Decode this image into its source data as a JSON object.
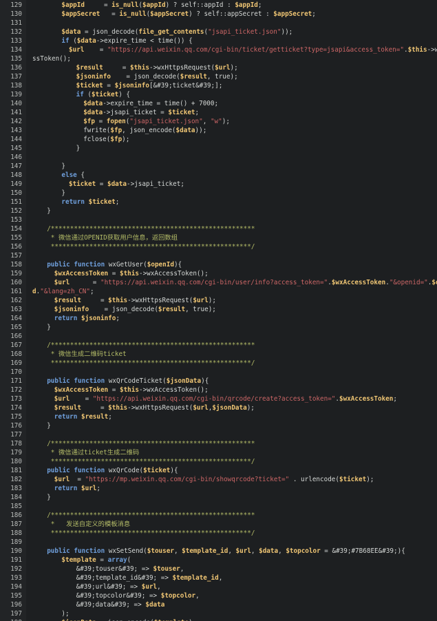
{
  "lines": [
    {
      "n": "129",
      "i": 4,
      "t": [
        [
          "v",
          "$appId"
        ],
        [
          "p",
          "     = "
        ],
        [
          "f",
          "is_null"
        ],
        [
          "p",
          "("
        ],
        [
          "v",
          "$appId"
        ],
        [
          "p",
          ") ? self::appId : "
        ],
        [
          "v",
          "$appId"
        ],
        [
          "p",
          ";"
        ]
      ]
    },
    {
      "n": "130",
      "i": 4,
      "t": [
        [
          "v",
          "$appSecret"
        ],
        [
          "p",
          "   = "
        ],
        [
          "f",
          "is_null"
        ],
        [
          "p",
          "("
        ],
        [
          "v",
          "$appSecret"
        ],
        [
          "p",
          ") ? self::appSecret : "
        ],
        [
          "v",
          "$appSecret"
        ],
        [
          "p",
          ";"
        ]
      ]
    },
    {
      "n": "131",
      "i": 0,
      "t": []
    },
    {
      "n": "132",
      "i": 4,
      "t": [
        [
          "v",
          "$data"
        ],
        [
          "p",
          " = json_decode("
        ],
        [
          "f",
          "file_get_contents"
        ],
        [
          "p",
          "("
        ],
        [
          "s",
          "\"jsapi_ticket.json\""
        ],
        [
          "p",
          "));"
        ]
      ]
    },
    {
      "n": "133",
      "i": 4,
      "t": [
        [
          "k",
          "if"
        ],
        [
          "p",
          " ("
        ],
        [
          "v",
          "$data"
        ],
        [
          "p",
          "->expire_time < time()) {"
        ]
      ]
    },
    {
      "n": "134",
      "i": 5,
      "t": [
        [
          "v",
          "$url"
        ],
        [
          "p",
          "    = "
        ],
        [
          "s",
          "\"https://api.weixin.qq.com/cgi-bin/ticket/getticket?type=jsapi&access_token=\""
        ],
        [
          "p",
          "."
        ],
        [
          "v",
          "$this"
        ],
        [
          "p",
          "->wxAcce"
        ]
      ]
    },
    {
      "n": "135",
      "i": 0,
      "t": [
        [
          "p",
          "ssToken();"
        ]
      ]
    },
    {
      "n": "136",
      "i": 6,
      "t": [
        [
          "v",
          "$result"
        ],
        [
          "p",
          "     = "
        ],
        [
          "v",
          "$this"
        ],
        [
          "p",
          "->wxHttpsRequest("
        ],
        [
          "v",
          "$url"
        ],
        [
          "p",
          ");"
        ]
      ]
    },
    {
      "n": "137",
      "i": 6,
      "t": [
        [
          "v",
          "$jsoninfo"
        ],
        [
          "p",
          "    = json_decode("
        ],
        [
          "v",
          "$result"
        ],
        [
          "p",
          ", true);"
        ]
      ]
    },
    {
      "n": "138",
      "i": 6,
      "t": [
        [
          "v",
          "$ticket"
        ],
        [
          "p",
          " = "
        ],
        [
          "v",
          "$jsoninfo"
        ],
        [
          "p",
          "[&#39;ticket&#39;];"
        ]
      ]
    },
    {
      "n": "139",
      "i": 6,
      "t": [
        [
          "k",
          "if"
        ],
        [
          "p",
          " ("
        ],
        [
          "v",
          "$ticket"
        ],
        [
          "p",
          ") {"
        ]
      ]
    },
    {
      "n": "140",
      "i": 7,
      "t": [
        [
          "v",
          "$data"
        ],
        [
          "p",
          "->expire_time = time() + 7000;"
        ]
      ]
    },
    {
      "n": "141",
      "i": 7,
      "t": [
        [
          "v",
          "$data"
        ],
        [
          "p",
          "->jsapi_ticket = "
        ],
        [
          "v",
          "$ticket"
        ],
        [
          "p",
          ";"
        ]
      ]
    },
    {
      "n": "142",
      "i": 7,
      "t": [
        [
          "v",
          "$fp"
        ],
        [
          "p",
          " = "
        ],
        [
          "f",
          "fopen"
        ],
        [
          "p",
          "("
        ],
        [
          "s",
          "\"jsapi_ticket.json\""
        ],
        [
          "p",
          ", "
        ],
        [
          "s",
          "\"w\""
        ],
        [
          "p",
          ");"
        ]
      ]
    },
    {
      "n": "143",
      "i": 7,
      "t": [
        [
          "p",
          "fwrite("
        ],
        [
          "v",
          "$fp"
        ],
        [
          "p",
          ", json_encode("
        ],
        [
          "v",
          "$data"
        ],
        [
          "p",
          "));"
        ]
      ]
    },
    {
      "n": "144",
      "i": 7,
      "t": [
        [
          "p",
          "fclose("
        ],
        [
          "v",
          "$fp"
        ],
        [
          "p",
          ");"
        ]
      ]
    },
    {
      "n": "145",
      "i": 6,
      "t": [
        [
          "p",
          "}"
        ]
      ]
    },
    {
      "n": "146",
      "i": 0,
      "t": []
    },
    {
      "n": "147",
      "i": 4,
      "t": [
        [
          "p",
          "}"
        ]
      ]
    },
    {
      "n": "148",
      "i": 4,
      "t": [
        [
          "k",
          "else"
        ],
        [
          "p",
          " {"
        ]
      ]
    },
    {
      "n": "149",
      "i": 5,
      "t": [
        [
          "v",
          "$ticket"
        ],
        [
          "p",
          " = "
        ],
        [
          "v",
          "$data"
        ],
        [
          "p",
          "->jsapi_ticket;"
        ]
      ]
    },
    {
      "n": "150",
      "i": 4,
      "t": [
        [
          "p",
          "}"
        ]
      ]
    },
    {
      "n": "151",
      "i": 4,
      "t": [
        [
          "k",
          "return"
        ],
        [
          "p",
          " "
        ],
        [
          "v",
          "$ticket"
        ],
        [
          "p",
          ";"
        ]
      ]
    },
    {
      "n": "152",
      "i": 2,
      "t": [
        [
          "p",
          "}"
        ]
      ]
    },
    {
      "n": "153",
      "i": 0,
      "t": []
    },
    {
      "n": "154",
      "i": 2,
      "t": [
        [
          "c",
          "/*****************************************************"
        ]
      ]
    },
    {
      "n": "155",
      "i": 2,
      "t": [
        [
          "c",
          " * 微信通过OPENID获取用户信息，返回数组"
        ]
      ]
    },
    {
      "n": "156",
      "i": 2,
      "t": [
        [
          "c",
          " ****************************************************/"
        ]
      ]
    },
    {
      "n": "157",
      "i": 0,
      "t": []
    },
    {
      "n": "158",
      "i": 2,
      "t": [
        [
          "k",
          "public"
        ],
        [
          "p",
          " "
        ],
        [
          "k",
          "function"
        ],
        [
          "p",
          " wxGetUser("
        ],
        [
          "v",
          "$openId"
        ],
        [
          "p",
          "){"
        ]
      ]
    },
    {
      "n": "159",
      "i": 3,
      "t": [
        [
          "v",
          "$wxAccessToken"
        ],
        [
          "p",
          " = "
        ],
        [
          "v",
          "$this"
        ],
        [
          "p",
          "->wxAccessToken();"
        ]
      ]
    },
    {
      "n": "160",
      "i": 3,
      "t": [
        [
          "v",
          "$url"
        ],
        [
          "p",
          "      = "
        ],
        [
          "s",
          "\"https://api.weixin.qq.com/cgi-bin/user/info?access_token=\""
        ],
        [
          "p",
          "."
        ],
        [
          "v",
          "$wxAccessToken"
        ],
        [
          "p",
          "."
        ],
        [
          "s",
          "\"&openid=\""
        ],
        [
          "p",
          "."
        ],
        [
          "v",
          "$openI"
        ]
      ]
    },
    {
      "n": "161",
      "i": 0,
      "t": [
        [
          "v",
          "d"
        ],
        [
          "p",
          "."
        ],
        [
          "s",
          "\"&lang=zh_CN\""
        ],
        [
          "p",
          ";"
        ]
      ]
    },
    {
      "n": "162",
      "i": 3,
      "t": [
        [
          "v",
          "$result"
        ],
        [
          "p",
          "     = "
        ],
        [
          "v",
          "$this"
        ],
        [
          "p",
          "->wxHttpsRequest("
        ],
        [
          "v",
          "$url"
        ],
        [
          "p",
          ");"
        ]
      ]
    },
    {
      "n": "163",
      "i": 3,
      "t": [
        [
          "v",
          "$jsoninfo"
        ],
        [
          "p",
          "    = json_decode("
        ],
        [
          "v",
          "$result"
        ],
        [
          "p",
          ", true);"
        ]
      ]
    },
    {
      "n": "164",
      "i": 3,
      "t": [
        [
          "k",
          "return"
        ],
        [
          "p",
          " "
        ],
        [
          "v",
          "$jsoninfo"
        ],
        [
          "p",
          ";"
        ]
      ]
    },
    {
      "n": "165",
      "i": 2,
      "t": [
        [
          "p",
          "}"
        ]
      ]
    },
    {
      "n": "166",
      "i": 0,
      "t": []
    },
    {
      "n": "167",
      "i": 2,
      "t": [
        [
          "c",
          "/*****************************************************"
        ]
      ]
    },
    {
      "n": "168",
      "i": 2,
      "t": [
        [
          "c",
          " * 微信生成二维码ticket"
        ]
      ]
    },
    {
      "n": "169",
      "i": 2,
      "t": [
        [
          "c",
          " ****************************************************/"
        ]
      ]
    },
    {
      "n": "170",
      "i": 0,
      "t": []
    },
    {
      "n": "171",
      "i": 2,
      "t": [
        [
          "k",
          "public"
        ],
        [
          "p",
          " "
        ],
        [
          "k",
          "function"
        ],
        [
          "p",
          " wxQrCodeTicket("
        ],
        [
          "v",
          "$jsonData"
        ],
        [
          "p",
          "){"
        ]
      ]
    },
    {
      "n": "172",
      "i": 3,
      "t": [
        [
          "v",
          "$wxAccessToken"
        ],
        [
          "p",
          " = "
        ],
        [
          "v",
          "$this"
        ],
        [
          "p",
          "->wxAccessToken();"
        ]
      ]
    },
    {
      "n": "173",
      "i": 3,
      "t": [
        [
          "v",
          "$url"
        ],
        [
          "p",
          "    = "
        ],
        [
          "s",
          "\"https://api.weixin.qq.com/cgi-bin/qrcode/create?access_token=\""
        ],
        [
          "p",
          "."
        ],
        [
          "v",
          "$wxAccessToken"
        ],
        [
          "p",
          ";"
        ]
      ]
    },
    {
      "n": "174",
      "i": 3,
      "t": [
        [
          "v",
          "$result"
        ],
        [
          "p",
          "     = "
        ],
        [
          "v",
          "$this"
        ],
        [
          "p",
          "->wxHttpsRequest("
        ],
        [
          "v",
          "$url"
        ],
        [
          "p",
          ","
        ],
        [
          "v",
          "$jsonData"
        ],
        [
          "p",
          ");"
        ]
      ]
    },
    {
      "n": "175",
      "i": 3,
      "t": [
        [
          "k",
          "return"
        ],
        [
          "p",
          " "
        ],
        [
          "v",
          "$result"
        ],
        [
          "p",
          ";"
        ]
      ]
    },
    {
      "n": "176",
      "i": 2,
      "t": [
        [
          "p",
          "}"
        ]
      ]
    },
    {
      "n": "177",
      "i": 0,
      "t": []
    },
    {
      "n": "178",
      "i": 2,
      "t": [
        [
          "c",
          "/*****************************************************"
        ]
      ]
    },
    {
      "n": "179",
      "i": 2,
      "t": [
        [
          "c",
          " * 微信通过ticket生成二维码"
        ]
      ]
    },
    {
      "n": "180",
      "i": 2,
      "t": [
        [
          "c",
          " ****************************************************/"
        ]
      ]
    },
    {
      "n": "181",
      "i": 2,
      "t": [
        [
          "k",
          "public"
        ],
        [
          "p",
          " "
        ],
        [
          "k",
          "function"
        ],
        [
          "p",
          " wxQrCode("
        ],
        [
          "v",
          "$ticket"
        ],
        [
          "p",
          "){"
        ]
      ]
    },
    {
      "n": "182",
      "i": 3,
      "t": [
        [
          "v",
          "$url"
        ],
        [
          "p",
          "  = "
        ],
        [
          "s",
          "\"https://mp.weixin.qq.com/cgi-bin/showqrcode?ticket=\""
        ],
        [
          "p",
          " . urlencode("
        ],
        [
          "v",
          "$ticket"
        ],
        [
          "p",
          ");"
        ]
      ]
    },
    {
      "n": "183",
      "i": 3,
      "t": [
        [
          "k",
          "return"
        ],
        [
          "p",
          " "
        ],
        [
          "v",
          "$url"
        ],
        [
          "p",
          ";"
        ]
      ]
    },
    {
      "n": "184",
      "i": 2,
      "t": [
        [
          "p",
          "}"
        ]
      ]
    },
    {
      "n": "185",
      "i": 0,
      "t": []
    },
    {
      "n": "186",
      "i": 2,
      "t": [
        [
          "c",
          "/*****************************************************"
        ]
      ]
    },
    {
      "n": "187",
      "i": 2,
      "t": [
        [
          "c",
          " *   发送自定义的模板消息"
        ]
      ]
    },
    {
      "n": "188",
      "i": 2,
      "t": [
        [
          "c",
          " ****************************************************/"
        ]
      ]
    },
    {
      "n": "189",
      "i": 0,
      "t": []
    },
    {
      "n": "190",
      "i": 2,
      "t": [
        [
          "k",
          "public"
        ],
        [
          "p",
          " "
        ],
        [
          "k",
          "function"
        ],
        [
          "p",
          " wxSetSend("
        ],
        [
          "v",
          "$touser"
        ],
        [
          "p",
          ", "
        ],
        [
          "v",
          "$template_id"
        ],
        [
          "p",
          ", "
        ],
        [
          "v",
          "$url"
        ],
        [
          "p",
          ", "
        ],
        [
          "v",
          "$data"
        ],
        [
          "p",
          ", "
        ],
        [
          "v",
          "$topcolor"
        ],
        [
          "p",
          " = &#39;#7B68EE&#39;){"
        ]
      ]
    },
    {
      "n": "191",
      "i": 4,
      "t": [
        [
          "v",
          "$template"
        ],
        [
          "p",
          " = "
        ],
        [
          "k",
          "array"
        ],
        [
          "p",
          "("
        ]
      ]
    },
    {
      "n": "192",
      "i": 6,
      "t": [
        [
          "p",
          "&#39;touser&#39; => "
        ],
        [
          "v",
          "$touser"
        ],
        [
          "p",
          ","
        ]
      ]
    },
    {
      "n": "193",
      "i": 6,
      "t": [
        [
          "p",
          "&#39;template_id&#39; => "
        ],
        [
          "v",
          "$template_id"
        ],
        [
          "p",
          ","
        ]
      ]
    },
    {
      "n": "194",
      "i": 6,
      "t": [
        [
          "p",
          "&#39;url&#39; => "
        ],
        [
          "v",
          "$url"
        ],
        [
          "p",
          ","
        ]
      ]
    },
    {
      "n": "195",
      "i": 6,
      "t": [
        [
          "p",
          "&#39;topcolor&#39; => "
        ],
        [
          "v",
          "$topcolor"
        ],
        [
          "p",
          ","
        ]
      ]
    },
    {
      "n": "196",
      "i": 6,
      "t": [
        [
          "p",
          "&#39;data&#39; => "
        ],
        [
          "v",
          "$data"
        ]
      ]
    },
    {
      "n": "197",
      "i": 4,
      "t": [
        [
          "p",
          ");"
        ]
      ]
    },
    {
      "n": "198",
      "i": 4,
      "t": [
        [
          "v",
          "$jsonData"
        ],
        [
          "p",
          " = json_encode("
        ],
        [
          "v",
          "$template"
        ],
        [
          "p",
          ");"
        ]
      ]
    }
  ]
}
